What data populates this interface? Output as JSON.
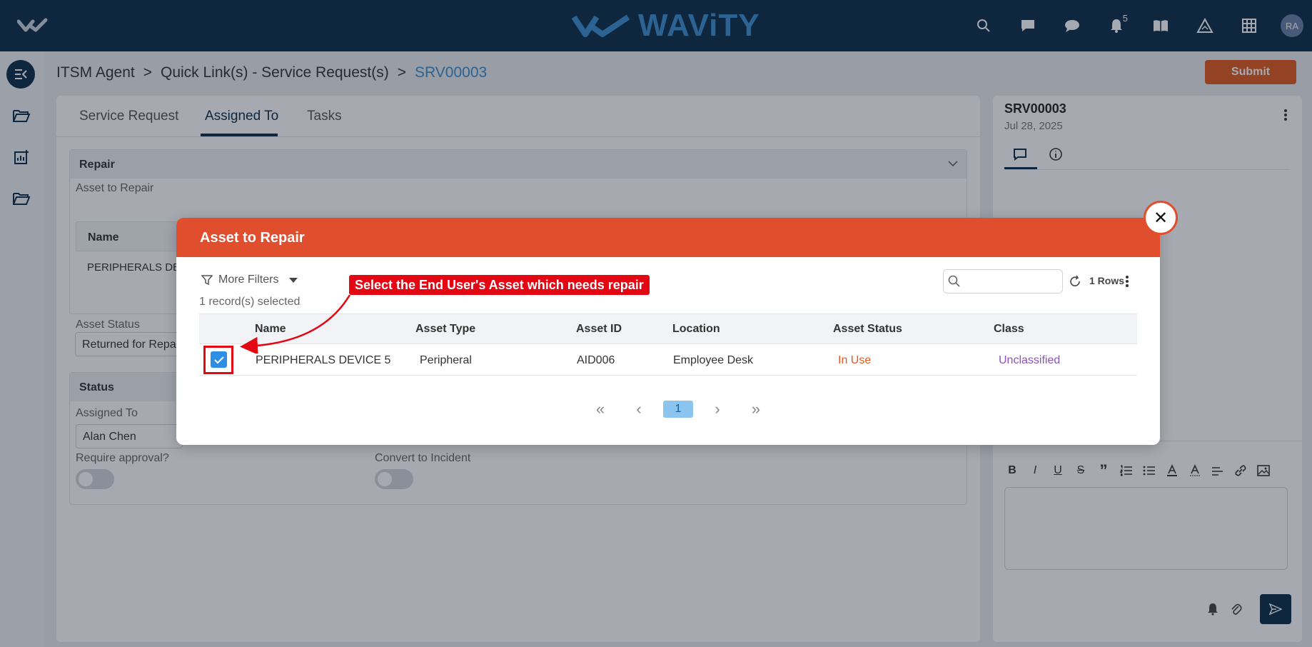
{
  "topbar": {
    "brand": "WAViTY",
    "notification_count": "5",
    "avatar_initials": "RA",
    "icons": [
      "search-icon",
      "chat-icon",
      "messages-icon",
      "bell-icon",
      "book-icon",
      "warning-icon",
      "grid-icon"
    ]
  },
  "breadcrumb": {
    "items": [
      "ITSM Agent",
      "Quick Link(s) - Service Request(s)"
    ],
    "current": "SRV00003",
    "separator": ">"
  },
  "actions": {
    "submit_label": "Submit"
  },
  "main": {
    "tabs": [
      {
        "label": "Service Request",
        "active": false
      },
      {
        "label": "Assigned To",
        "active": true
      },
      {
        "label": "Tasks",
        "active": false
      }
    ],
    "repair_section": {
      "title": "Repair",
      "asset_to_repair_label": "Asset to Repair",
      "table_header_name": "Name",
      "table_row_name": "PERIPHERALS DE",
      "asset_status_label": "Asset Status",
      "asset_status_value": "Returned for Repai"
    },
    "status_section": {
      "title": "Status",
      "assigned_to_label": "Assigned To",
      "assigned_to_value": "Alan Chen",
      "require_approval_label": "Require approval?",
      "convert_to_incident_label": "Convert to Incident"
    }
  },
  "right_panel": {
    "title": "SRV00003",
    "date": "Jul 28, 2025",
    "toolbar": [
      "B",
      "I",
      "U",
      "S",
      "”"
    ]
  },
  "modal": {
    "title": "Asset to Repair",
    "close_label": "✕",
    "filters_label": "More Filters",
    "selected_count": "1 record(s) selected",
    "search_placeholder": "",
    "rows_label": "1 Rows",
    "columns": [
      "Name",
      "Asset Type",
      "Asset ID",
      "Location",
      "Asset Status",
      "Class"
    ],
    "rows": [
      {
        "checked": true,
        "name": "PERIPHERALS DEVICE 5",
        "asset_type": "Peripheral",
        "asset_id": "AID006",
        "location": "Employee Desk",
        "asset_status": "In Use",
        "class": "Unclassified"
      }
    ],
    "pager": {
      "first": "«",
      "prev": "‹",
      "current": "1",
      "next": "›",
      "last": "»"
    }
  },
  "annotation": {
    "text": "Select the End User's Asset which needs repair"
  },
  "colors": {
    "topbar": "#0a2d4a",
    "accent": "#3b8fd0",
    "modal_header": "#e04e2e",
    "submit": "#e05a1e",
    "annotation": "#e30613"
  }
}
